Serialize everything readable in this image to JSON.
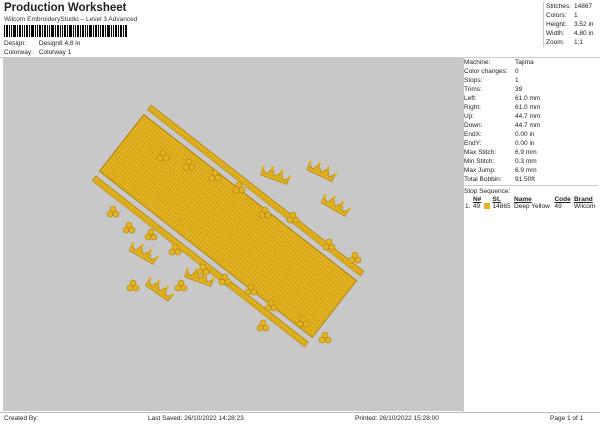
{
  "header": {
    "title": "Production Worksheet",
    "subtitle": "Wilcom EmbroideryStudio – Level 3 Advanced",
    "design_label": "Design:",
    "design_value": "Design8 4,8 in",
    "colorway_label": "Colorway:",
    "colorway_value": "Colorway 1"
  },
  "stats": [
    {
      "k": "Stitches:",
      "v": "14867"
    },
    {
      "k": "Colors:",
      "v": "1"
    },
    {
      "k": "Height:",
      "v": "3.52 in"
    },
    {
      "k": "Width:",
      "v": "4.80 in"
    },
    {
      "k": "Zoom:",
      "v": "1:1"
    }
  ],
  "info": [
    {
      "k": "Machine:",
      "v": "Tajima"
    },
    {
      "k": "Color changes:",
      "v": "0"
    },
    {
      "k": "Stops:",
      "v": "1"
    },
    {
      "k": "Trims:",
      "v": "39"
    },
    {
      "k": "Left:",
      "v": "61.0 mm"
    },
    {
      "k": "Right:",
      "v": "61.0 mm"
    },
    {
      "k": "Up:",
      "v": "44.7 mm"
    },
    {
      "k": "Down:",
      "v": "44.7 mm"
    },
    {
      "k": "EndX:",
      "v": "0.00 in"
    },
    {
      "k": "EndY:",
      "v": "0.00 in"
    },
    {
      "k": "Max Stitch:",
      "v": "6.9 mm"
    },
    {
      "k": "Min Stitch:",
      "v": "0.3 mm"
    },
    {
      "k": "Max Jump:",
      "v": "6.9 mm"
    },
    {
      "k": "Total Bobbin:",
      "v": "91.50ft"
    }
  ],
  "sequence": {
    "title": "Stop Sequence:",
    "headers": [
      "",
      "N#",
      "",
      "St.",
      "Name",
      "Code",
      "Brand"
    ],
    "rows": [
      {
        "idx": "1.",
        "n": "49",
        "stitches": "14865",
        "name": "Deep Yellow",
        "code": "49",
        "brand": "Wilcom",
        "color": "#e3b321"
      }
    ]
  },
  "footer": {
    "created": "Created By:",
    "saved": "Last Saved: 26/10/2022 14:28:23",
    "printed": "Printed: 26/10/2022 15:28:00",
    "page": "Page 1 of 1"
  },
  "colors": {
    "thread": "#e3b321",
    "thread_dark": "#b08310",
    "background": "#c8c8c8"
  }
}
